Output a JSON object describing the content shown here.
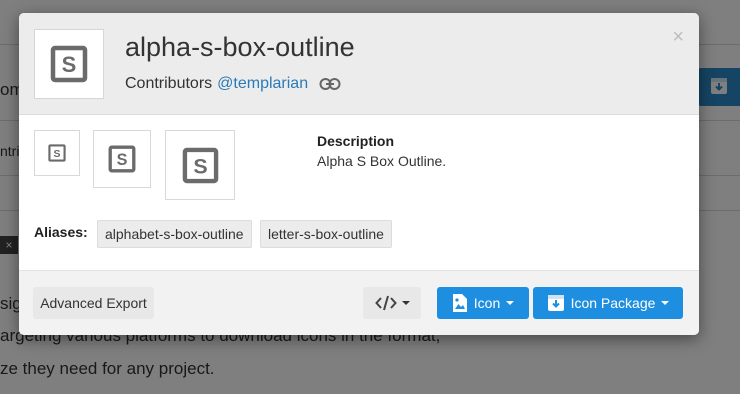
{
  "background": {
    "fragment_1": "om",
    "fragment_2": "ntri",
    "fragment_3": "sig",
    "line_1": "argeting various platforms to download icons in the format,",
    "line_2": "ze they need for any project.",
    "dismiss_glyph": "×"
  },
  "modal": {
    "title": "alpha-s-box-outline",
    "contributors_label": "Contributors",
    "contributor": "@templarian",
    "link_icon": "link-icon",
    "close_glyph": "×",
    "description_label": "Description",
    "description_text": "Alpha S Box Outline.",
    "aliases_label": "Aliases:",
    "aliases": [
      "alphabet-s-box-outline",
      "letter-s-box-outline"
    ],
    "icon_glyph": "S",
    "footer": {
      "advanced_export": "Advanced Export",
      "code_icon": "code-icon",
      "icon_button": "Icon",
      "icon_package_button": "Icon Package"
    }
  },
  "colors": {
    "accent": "#1e8fe0",
    "link": "#2a7ab8",
    "icon_gray": "#6b6b6b"
  }
}
